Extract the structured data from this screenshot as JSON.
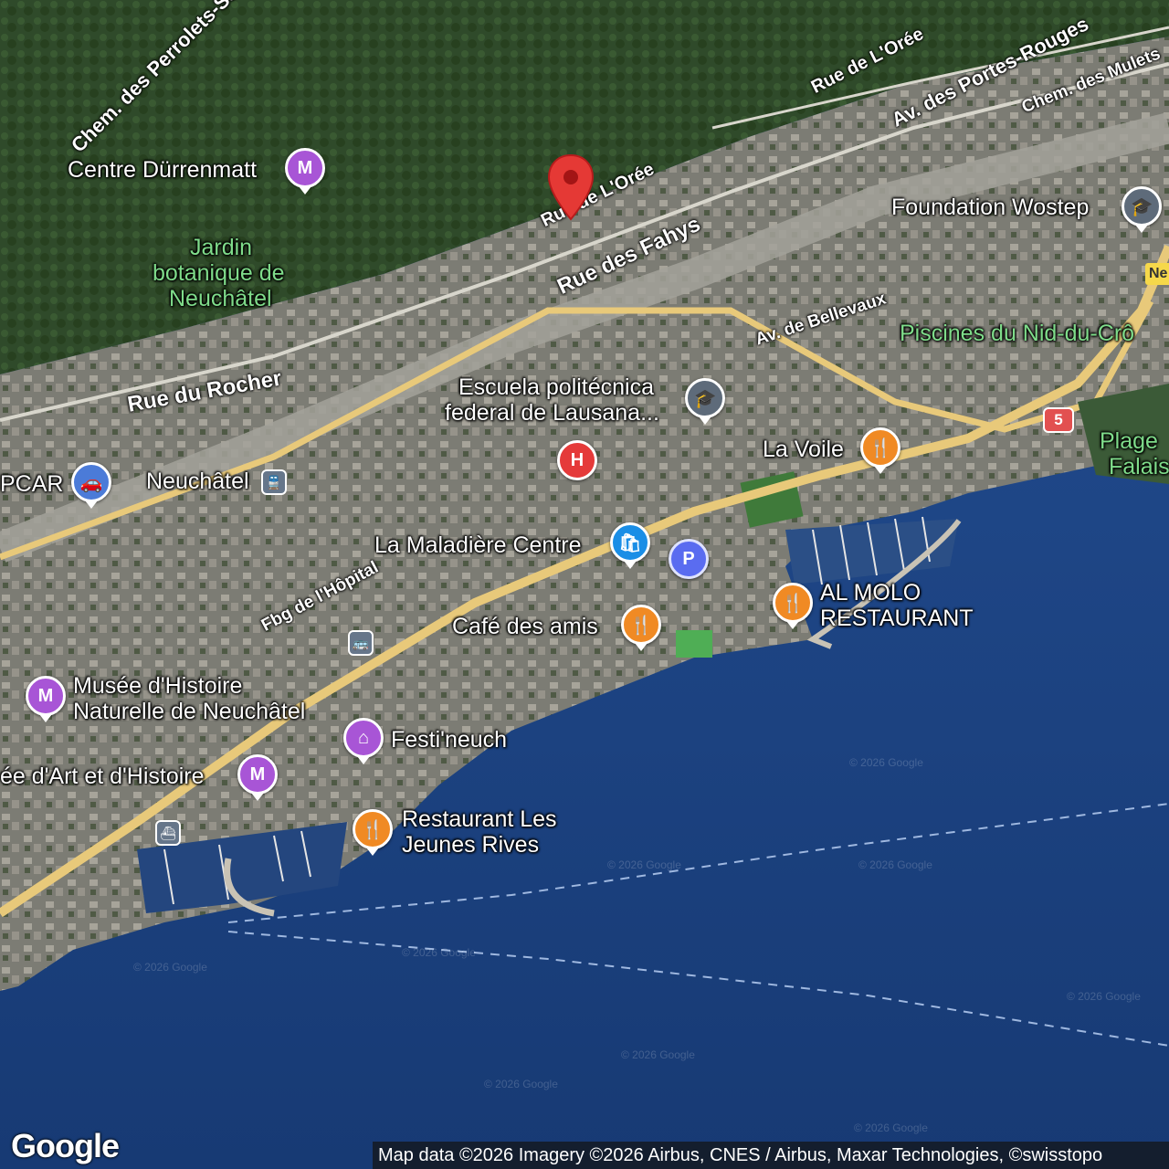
{
  "map": {
    "colors": {
      "forest": "#2f4a2a",
      "urban": "#8a8a82",
      "lake": "#1b3f7c",
      "highway": "#e8c97a",
      "rail": "#9b9b95"
    },
    "watermark": "© 2026 Google"
  },
  "roads": [
    {
      "name": "Chem. des Perrolets-Saint-Je"
    },
    {
      "name": "Rue de L'Orée"
    },
    {
      "name": "Av. des Portes-Rouges"
    },
    {
      "name": "Chem. des Mulets"
    },
    {
      "name": "Rue de L'Orée"
    },
    {
      "name": "Rue des Fahys"
    },
    {
      "name": "Av. de Bellevaux"
    },
    {
      "name": "Rue du Rocher"
    },
    {
      "name": "Fbg de l'Hôpital"
    }
  ],
  "places": {
    "centre_durrenmatt": "Centre Dürrenmatt",
    "jardin": "Jardin botanique de Neuchâtel",
    "jardin_l1": "Jardin",
    "jardin_l2": "botanique de",
    "jardin_l3": "Neuchâtel",
    "wostep": "Foundation Wostep",
    "piscines": "Piscines du Nid-du-Crô",
    "epfl_l1": "Escuela politécnica",
    "epfl_l2": "federal de Lausana...",
    "la_voile": "La Voile",
    "plage_l1": "Plage",
    "plage_l2": "Falais",
    "pcar": "PCAR",
    "neuchatel": "Neuchâtel",
    "maladiere": "La Maladière Centre",
    "al_molo_l1": "AL MOLO",
    "al_molo_l2": "RESTAURANT",
    "cafe": "Café des amis",
    "musee_hn_l1": "Musée d'Histoire",
    "musee_hn_l2": "Naturelle de Neuchâtel",
    "festineuch": "Festi'neuch",
    "musee_art": "ée d'Art et d'Histoire",
    "jeunes_rives_l1": "Restaurant Les",
    "jeunes_rives_l2": "Jeunes Rives"
  },
  "icons": {
    "museum": "M",
    "food": "🍴",
    "edu": "🎓",
    "shop": "🛍",
    "hospital": "H",
    "parking": "P",
    "car": "🚗",
    "train": "🚆",
    "bus": "🚌",
    "ferry": "⛴",
    "castle": "⌂"
  },
  "shields": {
    "route5": "5",
    "highway": "Ne"
  },
  "footer": {
    "logo": "Google",
    "attribution": "Map data ©2026 Imagery ©2026 Airbus, CNES / Airbus, Maxar Technologies, ©swisstopo"
  }
}
